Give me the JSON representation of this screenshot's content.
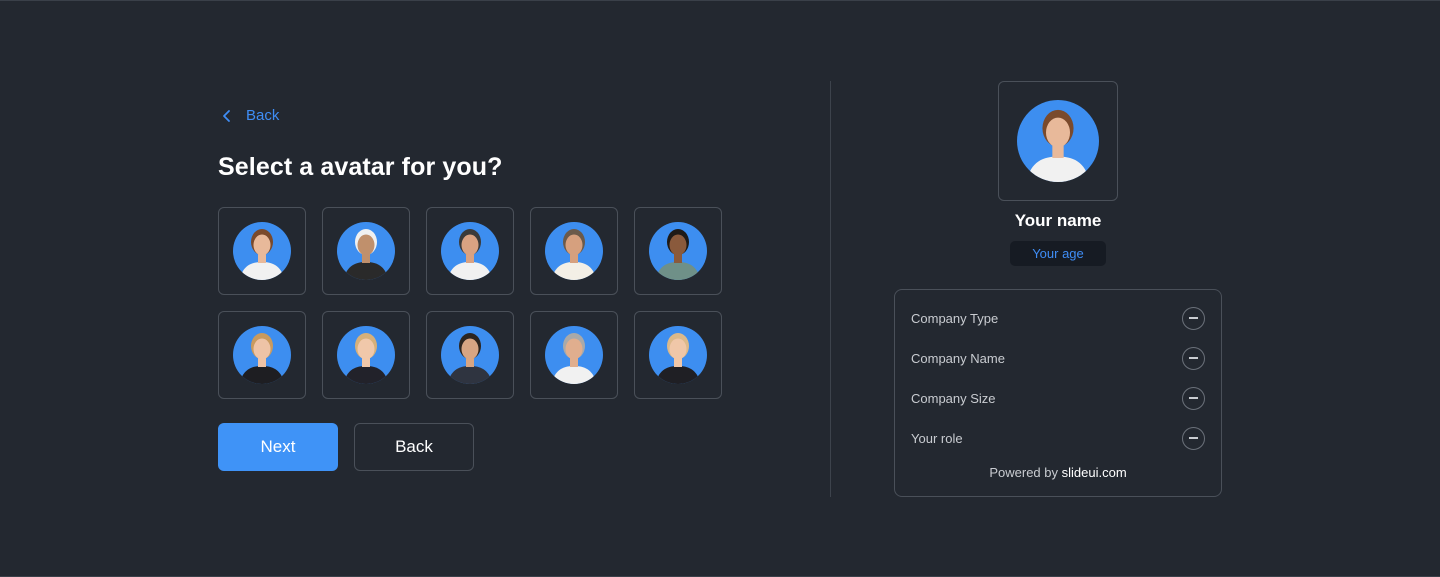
{
  "nav": {
    "back_link_label": "Back"
  },
  "heading": "Select a avatar for you?",
  "colors": {
    "background": "#232830",
    "accent": "#3f93f7",
    "avatar_bg": "#3d8ef0",
    "border": "#4a5059"
  },
  "avatars": [
    {
      "id": "woman-glasses-white-shirt",
      "hair": "#7a4a2c",
      "top": "#f1f1f1",
      "skin": "#e8b99a"
    },
    {
      "id": "man-beard-kufi",
      "hair": "#f0f0f0",
      "top": "#2a2a2a",
      "skin": "#c0906c"
    },
    {
      "id": "man-bald-white-shirt",
      "hair": "#3a3a3a",
      "top": "#f1f1f1",
      "skin": "#d9a282"
    },
    {
      "id": "man-beard-crossed-arms",
      "hair": "#6b5a4a",
      "top": "#f3efe6",
      "skin": "#d6a07e"
    },
    {
      "id": "woman-curly-green-shirt",
      "hair": "#1e1a17",
      "top": "#6f9088",
      "skin": "#8a5a3c"
    },
    {
      "id": "woman-blonde-black-blazer",
      "hair": "#c99a5e",
      "top": "#1e1e22",
      "skin": "#eec3a6"
    },
    {
      "id": "woman-blonde-black-blazer-2",
      "hair": "#d6b07a",
      "top": "#22222a",
      "skin": "#f0c8aa"
    },
    {
      "id": "man-glasses-suit",
      "hair": "#2c2520",
      "top": "#2f3440",
      "skin": "#d7a583"
    },
    {
      "id": "man-grey-hair-tie",
      "hair": "#a9a9a9",
      "top": "#f1f1f1",
      "skin": "#e0ae8e"
    },
    {
      "id": "woman-blonde-black-blazer-3",
      "hair": "#dcb98a",
      "top": "#1f1f24",
      "skin": "#f0c7a8"
    }
  ],
  "buttons": {
    "next_label": "Next",
    "back_label": "Back"
  },
  "profile": {
    "name": "Your name",
    "age": "Your age",
    "fields": [
      "Company Type",
      "Company Name",
      "Company Size",
      "Your role"
    ],
    "powered_prefix": "Powered by",
    "powered_brand": "slideui.com"
  }
}
